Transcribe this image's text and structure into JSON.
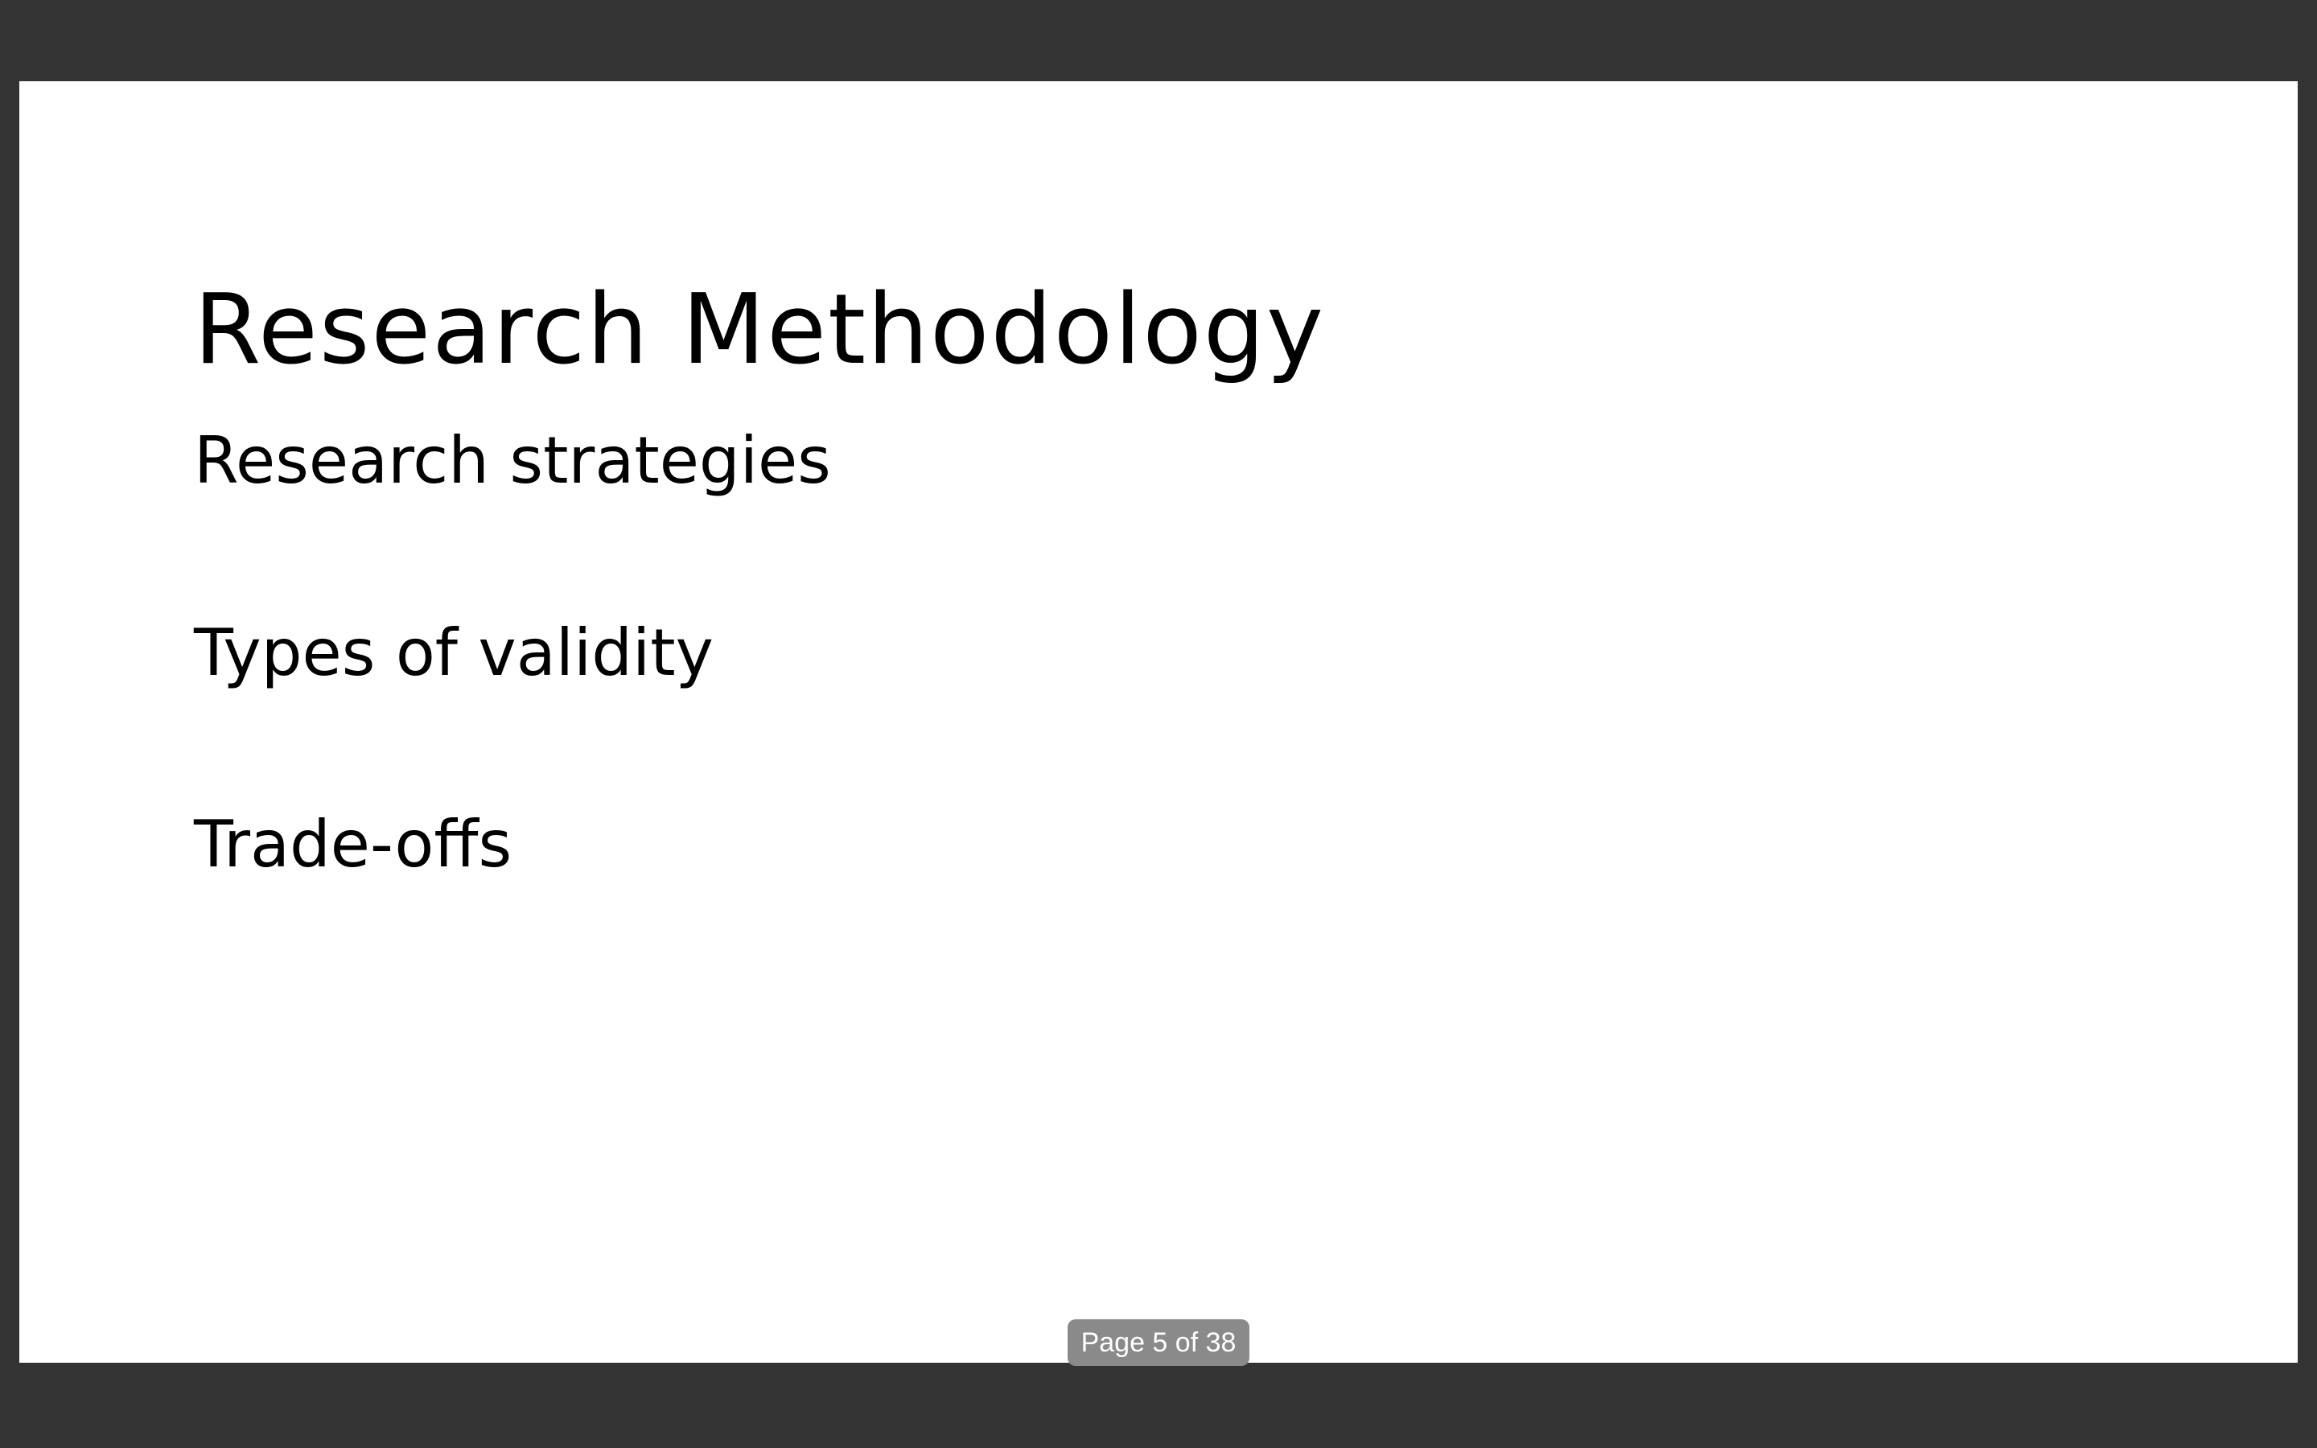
{
  "slide": {
    "title": "Research Methodology",
    "bullets": [
      "Research strategies",
      "Types of validity",
      "Trade-offs"
    ]
  },
  "page_indicator": {
    "text": "Page 5 of 38",
    "current_page": 5,
    "total_pages": 38
  },
  "colors": {
    "viewer_background": "#333333",
    "slide_background": "#ffffff",
    "text": "#000000",
    "indicator_background": "#8a8a8a",
    "indicator_text": "#ffffff"
  }
}
